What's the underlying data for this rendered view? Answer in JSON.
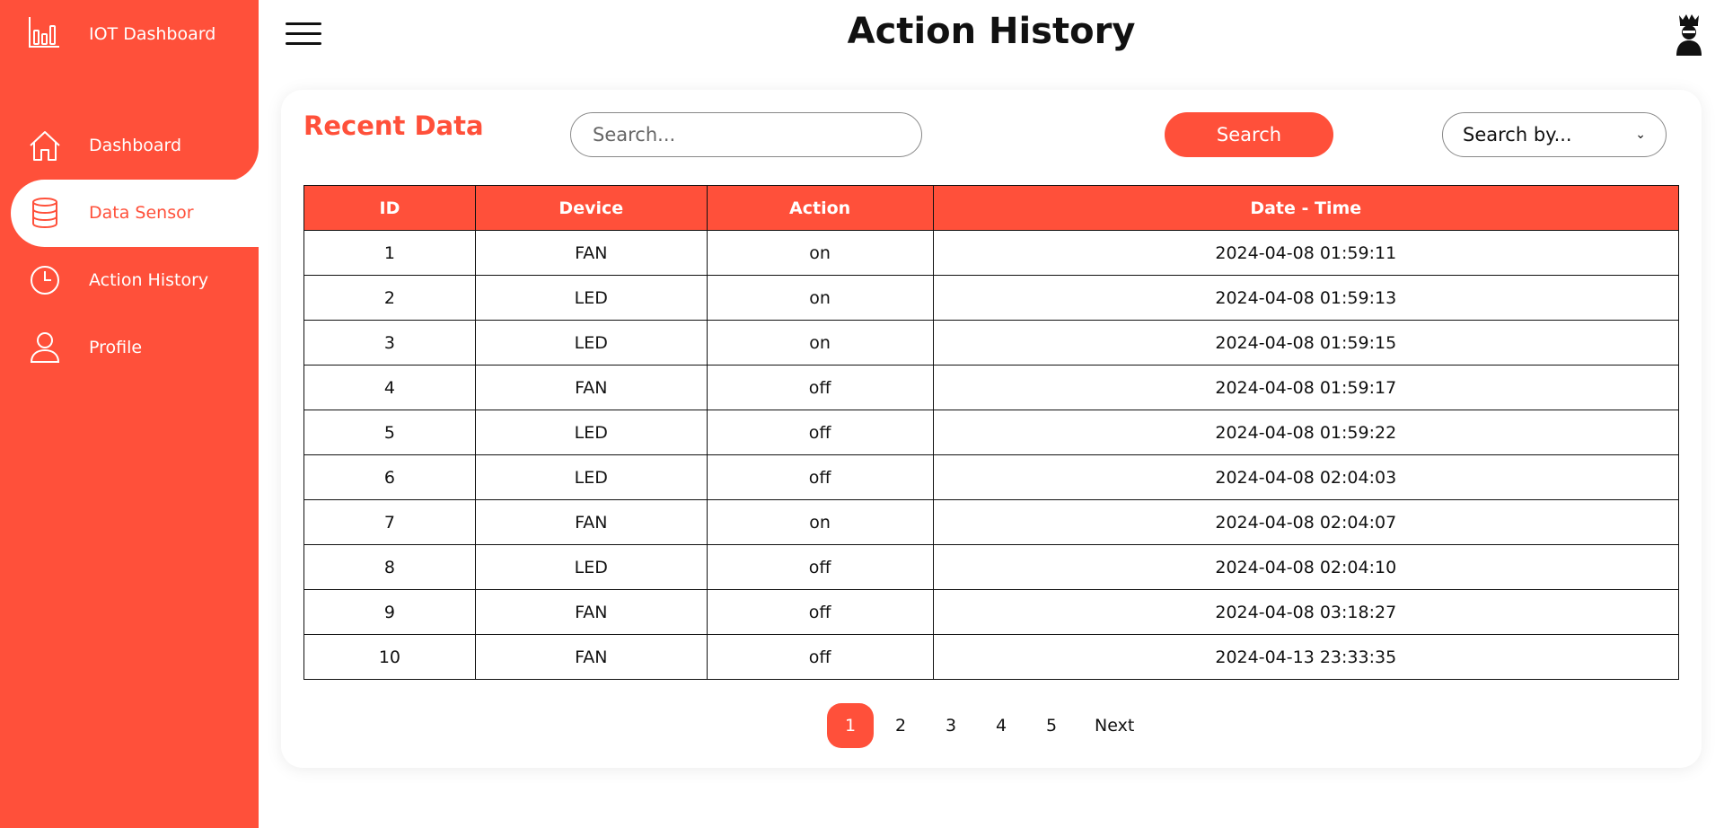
{
  "app": {
    "brand": "IOT Dashboard"
  },
  "sidebar": {
    "items": [
      {
        "label": "Dashboard",
        "icon": "home-icon"
      },
      {
        "label": "Data Sensor",
        "icon": "database-icon",
        "active": true
      },
      {
        "label": "Action History",
        "icon": "clock-icon"
      },
      {
        "label": "Profile",
        "icon": "user-icon"
      }
    ]
  },
  "header": {
    "title": "Action History"
  },
  "card": {
    "title": "Recent Data",
    "search_placeholder": "Search...",
    "search_button": "Search",
    "search_by": "Search by..."
  },
  "table": {
    "headers": [
      "ID",
      "Device",
      "Action",
      "Date - Time"
    ],
    "rows": [
      [
        "1",
        "FAN",
        "on",
        "2024-04-08 01:59:11"
      ],
      [
        "2",
        "LED",
        "on",
        "2024-04-08 01:59:13"
      ],
      [
        "3",
        "LED",
        "on",
        "2024-04-08 01:59:15"
      ],
      [
        "4",
        "FAN",
        "off",
        "2024-04-08 01:59:17"
      ],
      [
        "5",
        "LED",
        "off",
        "2024-04-08 01:59:22"
      ],
      [
        "6",
        "LED",
        "off",
        "2024-04-08 02:04:03"
      ],
      [
        "7",
        "FAN",
        "on",
        "2024-04-08 02:04:07"
      ],
      [
        "8",
        "LED",
        "off",
        "2024-04-08 02:04:10"
      ],
      [
        "9",
        "FAN",
        "off",
        "2024-04-08 03:18:27"
      ],
      [
        "10",
        "FAN",
        "off",
        "2024-04-13 23:33:35"
      ]
    ]
  },
  "pagination": {
    "pages": [
      "1",
      "2",
      "3",
      "4",
      "5"
    ],
    "current": "1",
    "next": "Next"
  },
  "colors": {
    "accent": "#ff503a"
  }
}
